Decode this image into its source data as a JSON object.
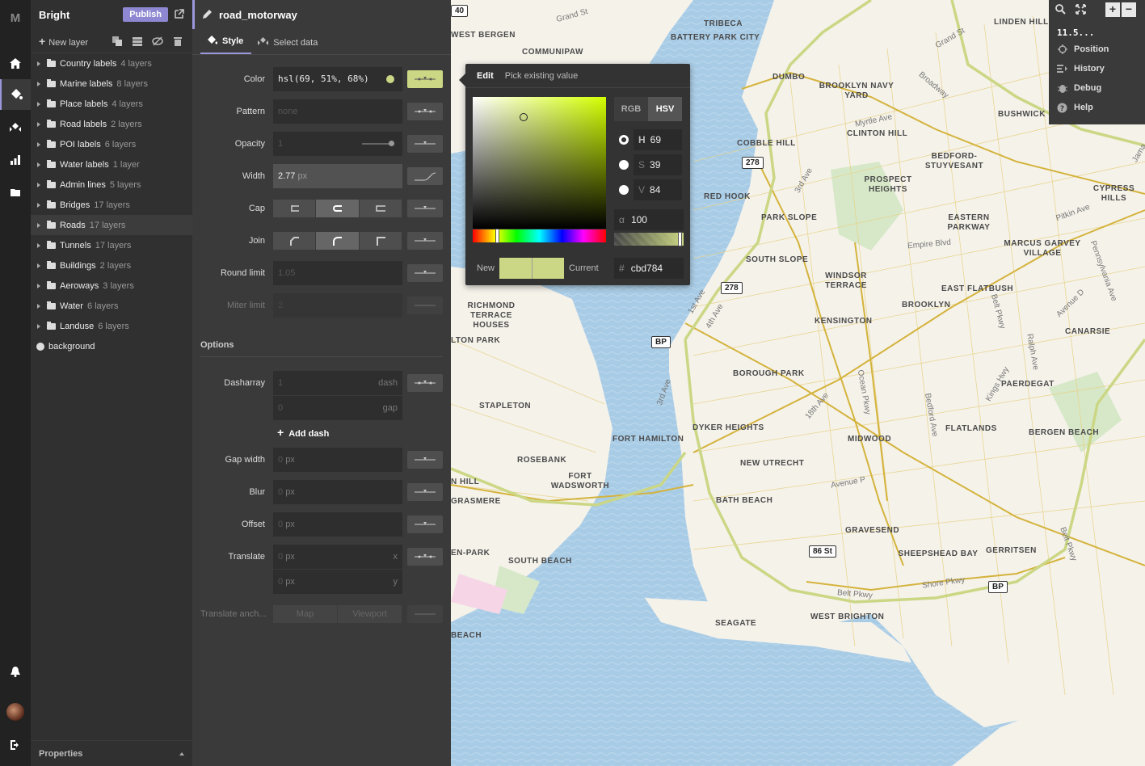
{
  "app": {
    "logo": "M"
  },
  "rail": {
    "items": [
      "home-icon",
      "paint-bucket-icon",
      "layers-icon",
      "stats-icon",
      "folder-icon"
    ]
  },
  "layers_panel": {
    "style_name": "Bright",
    "publish_label": "Publish",
    "new_layer_label": "New layer",
    "groups": [
      {
        "name": "Country labels",
        "count": "4 layers"
      },
      {
        "name": "Marine labels",
        "count": "8 layers"
      },
      {
        "name": "Place labels",
        "count": "4 layers"
      },
      {
        "name": "Road labels",
        "count": "2 layers"
      },
      {
        "name": "POI labels",
        "count": "6 layers"
      },
      {
        "name": "Water labels",
        "count": "1 layer"
      },
      {
        "name": "Admin lines",
        "count": "5 layers"
      },
      {
        "name": "Bridges",
        "count": "17 layers"
      },
      {
        "name": "Roads",
        "count": "17 layers"
      },
      {
        "name": "Tunnels",
        "count": "17 layers"
      },
      {
        "name": "Buildings",
        "count": "2 layers"
      },
      {
        "name": "Aeroways",
        "count": "3 layers"
      },
      {
        "name": "Water",
        "count": "6 layers"
      },
      {
        "name": "Landuse",
        "count": "6 layers"
      }
    ],
    "background_label": "background",
    "footer_label": "Properties"
  },
  "props_panel": {
    "layer_name": "road_motorway",
    "tabs": [
      "Style",
      "Select data"
    ],
    "color": {
      "label": "Color",
      "value": "hsl(69, 51%, 68%)"
    },
    "pattern": {
      "label": "Pattern",
      "placeholder": "none"
    },
    "opacity": {
      "label": "Opacity",
      "value": "1"
    },
    "width": {
      "label": "Width",
      "value": "2.77",
      "unit": "px"
    },
    "cap": {
      "label": "Cap"
    },
    "join": {
      "label": "Join"
    },
    "round_limit": {
      "label": "Round limit",
      "value": "1.05"
    },
    "miter_limit": {
      "label": "Miter limit",
      "value": "2"
    },
    "options_label": "Options",
    "dasharray": {
      "label": "Dasharray",
      "dash_value": "1",
      "dash_unit": "dash",
      "gap_value": "0",
      "gap_unit": "gap"
    },
    "add_dash_label": "Add dash",
    "gap_width": {
      "label": "Gap width",
      "value": "0",
      "unit": "px"
    },
    "blur": {
      "label": "Blur",
      "value": "0",
      "unit": "px"
    },
    "offset": {
      "label": "Offset",
      "value": "0",
      "unit": "px"
    },
    "translate": {
      "label": "Translate",
      "x_value": "0",
      "y_value": "0",
      "unit": "px",
      "x_axis": "x",
      "y_axis": "y"
    },
    "translate_anchor": {
      "label": "Translate anch...",
      "options": [
        "Map",
        "Viewport"
      ]
    }
  },
  "color_picker": {
    "tabs": [
      "Edit",
      "Pick existing value"
    ],
    "modes": [
      "RGB",
      "HSV"
    ],
    "h": {
      "label": "H",
      "value": "69"
    },
    "s": {
      "label": "S",
      "value": "39"
    },
    "v": {
      "label": "V",
      "value": "84"
    },
    "alpha": {
      "label": "α",
      "value": "100"
    },
    "hue_fraction": 0.19,
    "new_label": "New",
    "current_label": "Current",
    "hex": {
      "label": "#",
      "value": "cbd784"
    },
    "accent": "#cbd784"
  },
  "map_controls": {
    "zoom": "11.5...",
    "items": [
      "Position",
      "History",
      "Debug",
      "Help"
    ]
  },
  "map": {
    "labels": [
      "TRIBECA",
      "BATTERY PARK CITY",
      "WEST BERGEN",
      "COMMUNIPAW",
      "DUMBO",
      "BROOKLYN NAVY YARD",
      "LINDEN HILL",
      "BUSHWICK",
      "CLINTON HILL",
      "COBBLE HILL",
      "BEDFORD-STUYVESANT",
      "PROSPECT HEIGHTS",
      "RED HOOK",
      "PARK SLOPE",
      "EASTERN PARKWAY",
      "CYPRESS HILLS",
      "MARCUS GARVEY VILLAGE",
      "SOUTH SLOPE",
      "WINDSOR TERRACE",
      "EAST FLATBUSH",
      "BROOKLYN",
      "RICHMOND TERRACE HOUSES",
      "KENSINGTON",
      "CANARSIE",
      "LTON PARK",
      "BOROUGH PARK",
      "PAERDEGAT",
      "STAPLETON",
      "DYKER HEIGHTS",
      "FLATLANDS",
      "BERGEN BEACH",
      "FORT HAMILTON",
      "MIDWOOD",
      "ROSEBANK",
      "NEW UTRECHT",
      "N HILL",
      "FORT WADSWORTH",
      "GRASMERE",
      "BATH BEACH",
      "GRAVESEND",
      "EN-PARK",
      "SOUTH BEACH",
      "SHEEPSHEAD BAY",
      "GERRITSEN",
      "SEAGATE",
      "WEST BRIGHTON",
      "BEACH"
    ],
    "streets": [
      "Grand St",
      "Grand St",
      "Broadway",
      "Myrtle Ave",
      "3rd Ave",
      "Empire Blvd",
      "Pitkin Ave",
      "1st Ave",
      "4th Ave",
      "Ocean Pkwy",
      "Bedford Ave",
      "Kings Hwy",
      "Ralph Ave",
      "18th Ave",
      "3rd Ave",
      "Avenue P",
      "Belt Pkwy",
      "Shore Pkwy",
      "Belt Pkwy",
      "Belt Pkwy",
      "Pennsylvania Ave",
      "Avenue D",
      "Jama",
      "Cypr"
    ],
    "shields": [
      "278",
      "278",
      "BP",
      "86 St",
      "BP",
      "40"
    ]
  }
}
